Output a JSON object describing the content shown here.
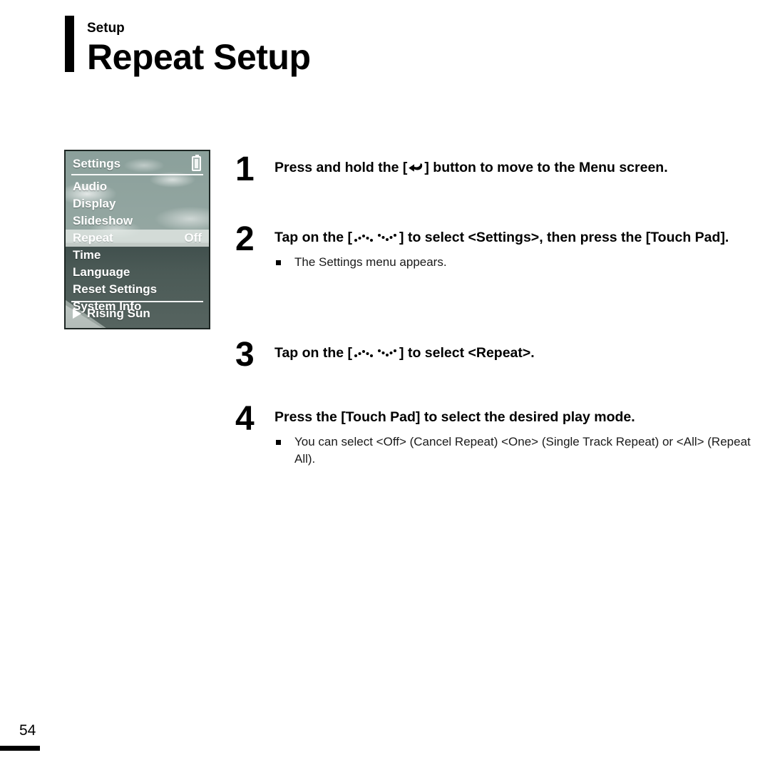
{
  "header": {
    "eyebrow": "Setup",
    "title": "Repeat Setup"
  },
  "device_screen": {
    "title": "Settings",
    "battery_icon": "battery-icon",
    "menu_items": [
      {
        "label": "Audio",
        "value": "",
        "selected": false
      },
      {
        "label": "Display",
        "value": "",
        "selected": false
      },
      {
        "label": "Slideshow",
        "value": "",
        "selected": false
      },
      {
        "label": "Repeat",
        "value": "Off",
        "selected": true
      },
      {
        "label": "Time",
        "value": "",
        "selected": false
      },
      {
        "label": "Language",
        "value": "",
        "selected": false
      },
      {
        "label": "Reset Settings",
        "value": "",
        "selected": false
      },
      {
        "label": "System Info",
        "value": "",
        "selected": false
      }
    ],
    "now_playing": {
      "play_icon": "play-icon",
      "track": "Rising Sun"
    }
  },
  "steps": [
    {
      "number": "1",
      "text_before": "Press and hold the [",
      "icon": "return-arrow-icon",
      "text_after": "] button to move to the Menu screen.",
      "note": ""
    },
    {
      "number": "2",
      "text_before": "Tap on the [",
      "icon": "touch-swipe-icon",
      "text_after": "] to select <Settings>, then press the [Touch Pad].",
      "note": "The Settings menu appears."
    },
    {
      "number": "3",
      "text_before": "Tap on the [",
      "icon": "touch-swipe-icon",
      "text_after": "] to select <Repeat>.",
      "note": ""
    },
    {
      "number": "4",
      "text_before": "Press the [Touch Pad] to select the desired play mode.",
      "icon": "",
      "text_after": "",
      "note": "You can select <Off> (Cancel Repeat) <One> (Single Track Repeat) or <All> (Repeat All)."
    }
  ],
  "footer": {
    "page_number": "54"
  }
}
